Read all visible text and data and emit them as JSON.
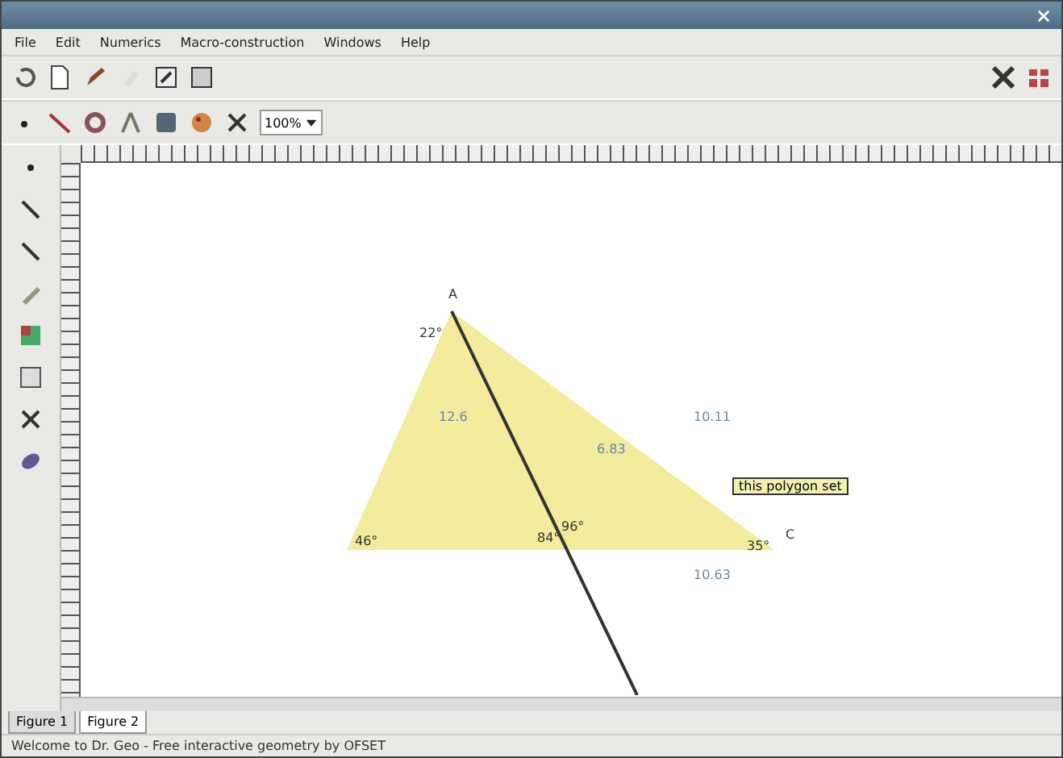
{
  "menu": [
    "File",
    "Edit",
    "Numerics",
    "Macro-construction",
    "Windows",
    "Help"
  ],
  "toolbar_size": {
    "value": "100%"
  },
  "figure": {
    "vertices": [
      "A",
      "C"
    ],
    "angles": [
      "22°",
      "46°",
      "84°",
      "96°",
      "35°"
    ],
    "measures": [
      "12.6",
      "6.83",
      "10.11",
      "10.63"
    ],
    "tooltip": "this polygon set"
  },
  "tabs": [
    {
      "label": "Figure 1",
      "selected": false
    },
    {
      "label": "Figure 2",
      "selected": true
    }
  ],
  "status_bar": "Welcome to Dr. Geo - Free interactive geometry by OFSET"
}
